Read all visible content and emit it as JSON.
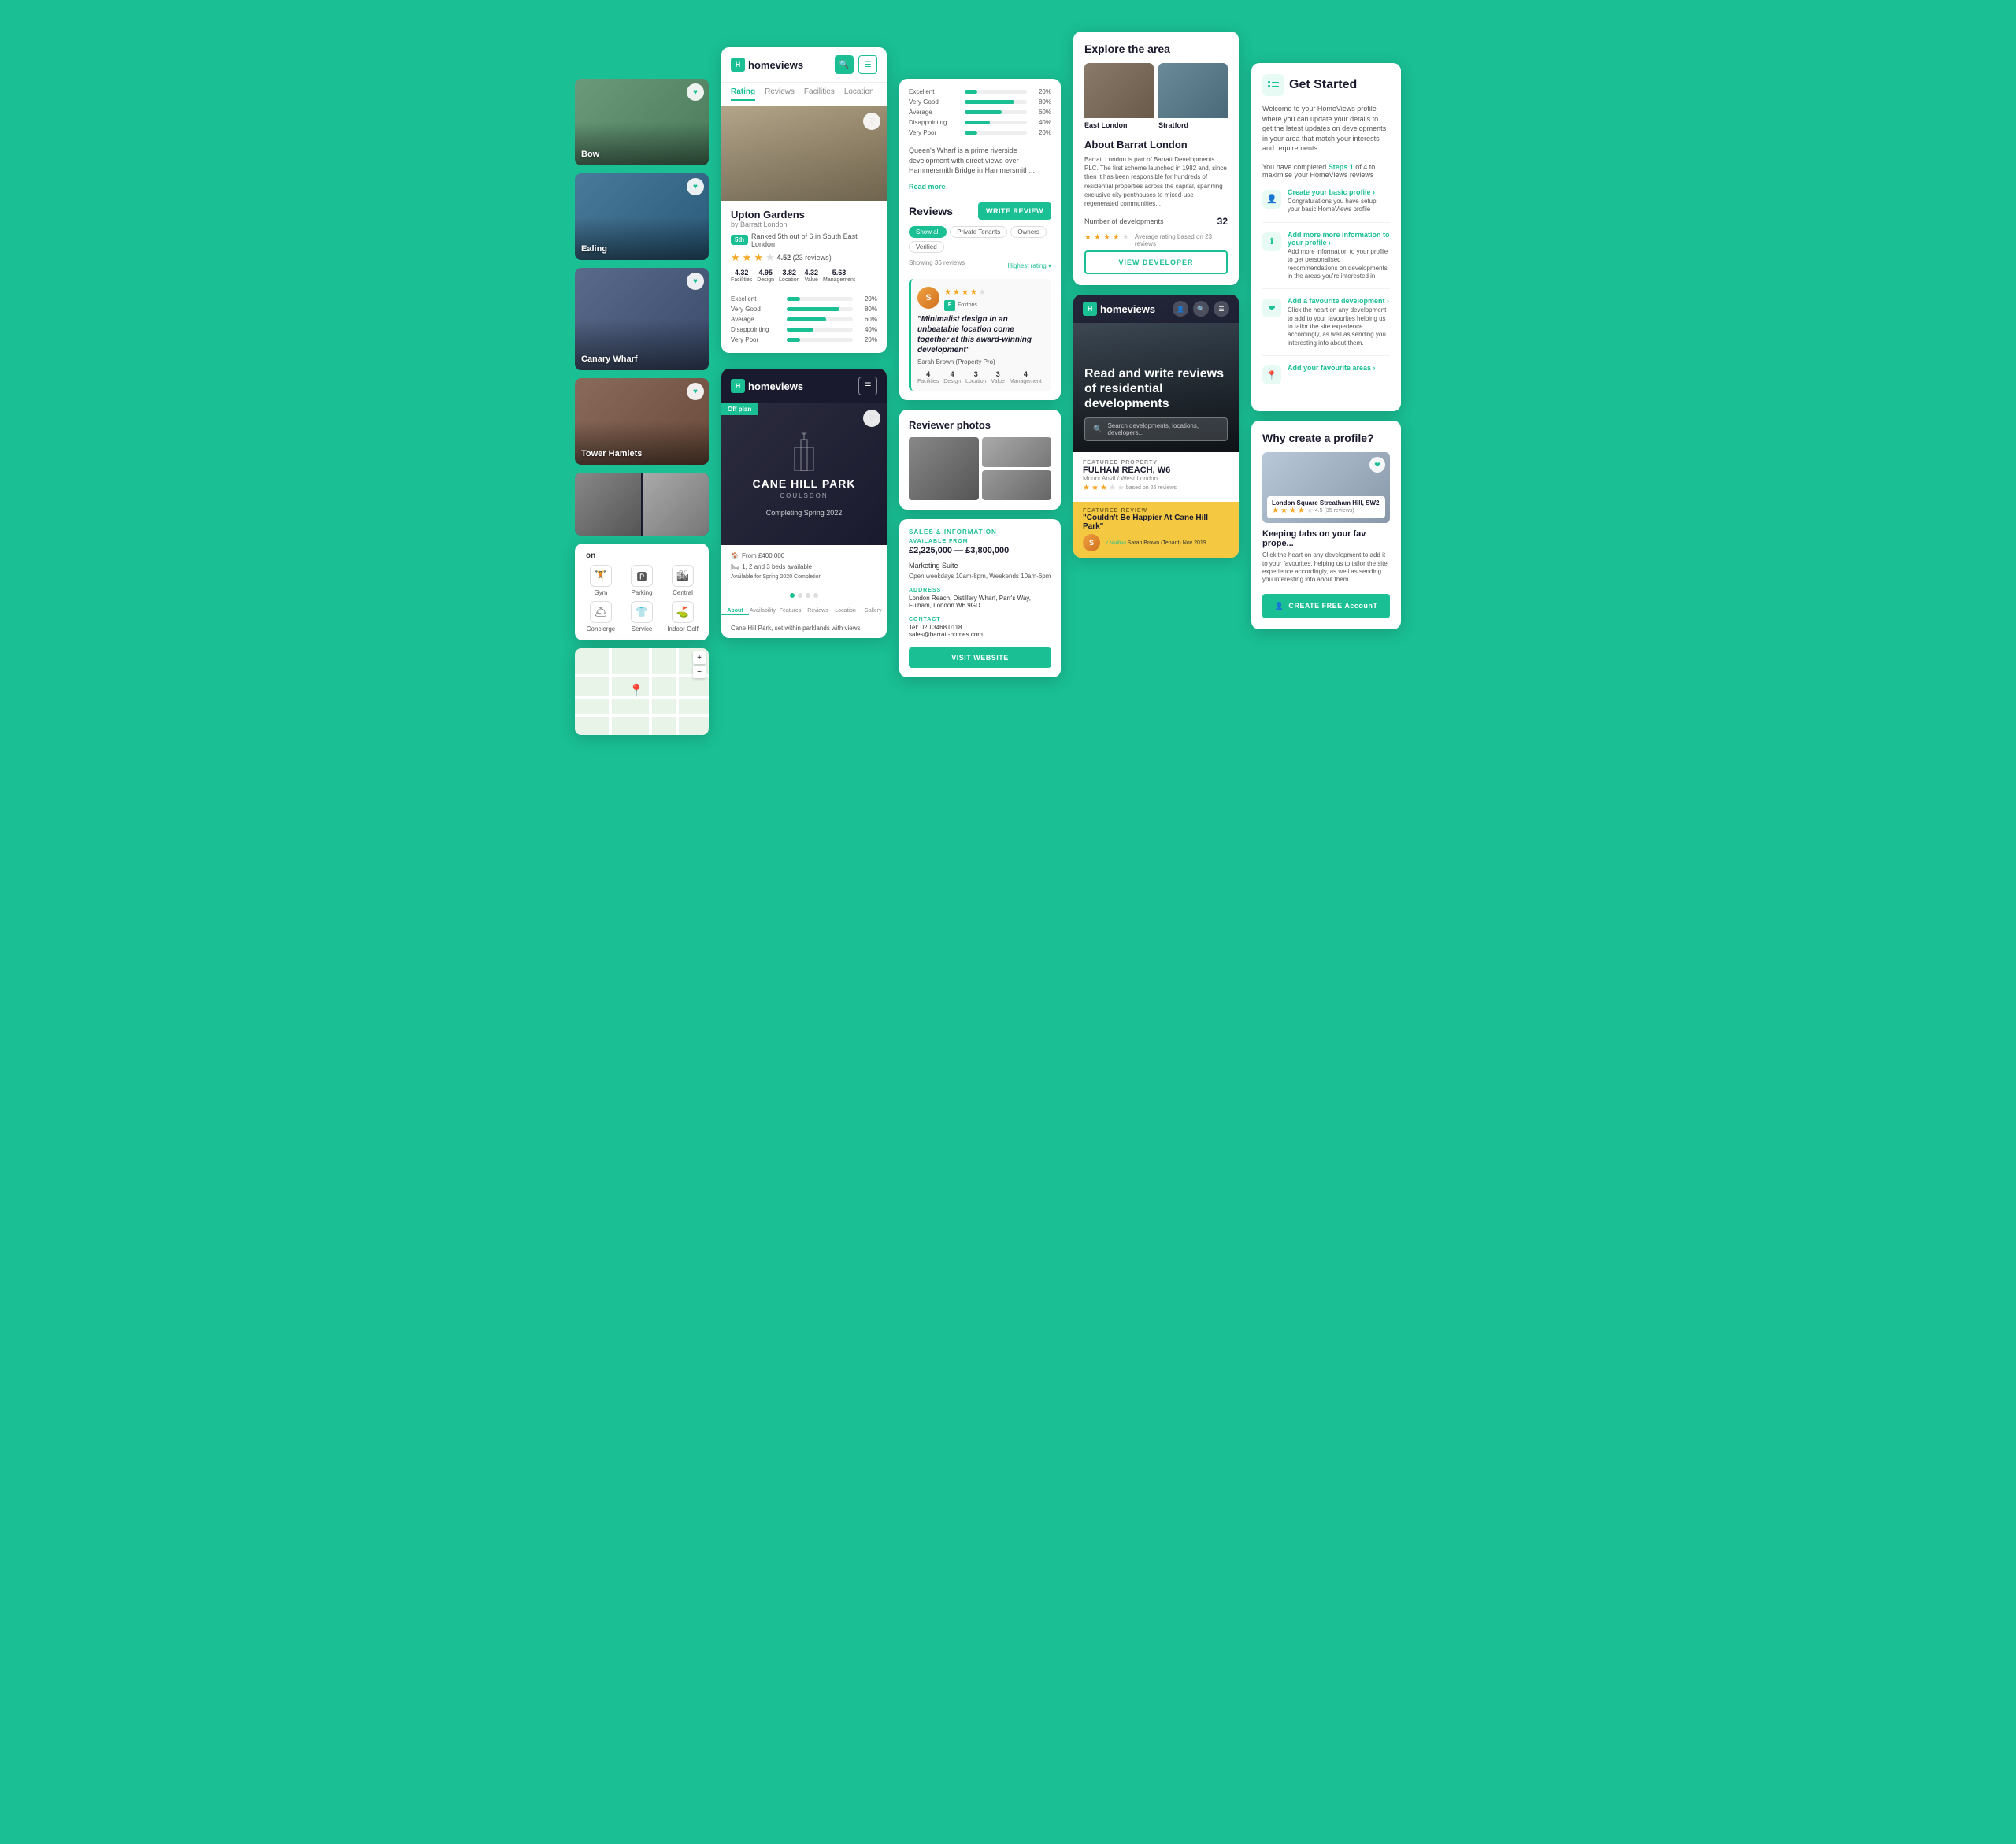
{
  "app": {
    "name": "HomeViews",
    "tagline": "Read and write reviews of residential developments"
  },
  "col1": {
    "locations": [
      {
        "name": "Bow",
        "colorClass": "img-bow"
      },
      {
        "name": "Ealing",
        "colorClass": "img-ealing"
      },
      {
        "name": "Canary Wharf",
        "colorClass": "img-canary"
      },
      {
        "name": "Tower Hamlets",
        "colorClass": "img-tower"
      }
    ],
    "amenities_title": "on",
    "amenities": [
      {
        "icon": "🏋",
        "label": "Gym"
      },
      {
        "icon": "🅿",
        "label": "Parking"
      },
      {
        "icon": "🏙",
        "label": "Central"
      },
      {
        "icon": "🛎",
        "label": "Concierge"
      },
      {
        "icon": "👕",
        "label": "Service"
      },
      {
        "icon": "⛳",
        "label": "Indoor Golf"
      }
    ]
  },
  "col2": {
    "nav_tabs": [
      "Rating",
      "Reviews",
      "Facilities",
      "Location"
    ],
    "property": {
      "name": "Upton Gardens",
      "developer": "by Barratt London",
      "rank_badge": "5th",
      "rank_text": "Ranked 5th out of 6 in South East London",
      "rating": "4.52",
      "review_count": "23 reviews",
      "sub_ratings": [
        {
          "val": "4.32",
          "label": "Facilities"
        },
        {
          "val": "4.95",
          "label": "Design"
        },
        {
          "val": "3.82",
          "label": "Location"
        },
        {
          "val": "4.32",
          "label": "Value"
        },
        {
          "val": "5.63",
          "label": "Management"
        }
      ],
      "rating_bars": [
        {
          "label": "Excellent",
          "pct": "20%",
          "fill": 20
        },
        {
          "label": "Very Good",
          "pct": "80%",
          "fill": 80
        },
        {
          "label": "Average",
          "pct": "60%",
          "fill": 60
        },
        {
          "label": "Disappointing",
          "pct": "40%",
          "fill": 40
        },
        {
          "label": "Very Poor",
          "pct": "20%",
          "fill": 20
        }
      ]
    },
    "cane_hill": {
      "badge": "Off plan",
      "title": "CANE HILL PARK",
      "subtitle": "COULSDON",
      "completing": "Completing Spring 2022",
      "price": "From £400,000",
      "beds": "1, 2 and 3 beds available",
      "availability": "Available for Spring 2020 Completion",
      "tabs": [
        "About",
        "Availability",
        "Features",
        "Reviews",
        "Location",
        "Gallery"
      ],
      "about_text": "Cane Hill Park, set within parklands with views"
    }
  },
  "col3": {
    "reviews_rating_bars": [
      {
        "label": "Excellent",
        "pct": "20%",
        "fill": 20
      },
      {
        "label": "Very Good",
        "pct": "80%",
        "fill": 80
      },
      {
        "label": "Average",
        "pct": "60%",
        "fill": 60
      },
      {
        "label": "Disappointing",
        "pct": "40%",
        "fill": 40
      },
      {
        "label": "Very Poor",
        "pct": "20%",
        "fill": 20
      }
    ],
    "description": "Queen's Wharf is a prime riverside development with direct views over Hammersmith Bridge in Hammersmith...",
    "read_more": "Read more",
    "reviews_section": {
      "title": "Reviews",
      "write_btn": "WRITE REVIEW",
      "show_all": "Show all",
      "filter_tags": [
        "Show all",
        "Private Tenants",
        "Owners",
        "Verified"
      ],
      "showing_text": "Showing 36 reviews",
      "sort": "Highest rating",
      "review": {
        "quote": "\"Minimalist design in an unbeatable location come together at this award-winning development\"",
        "reviewer": "Sarah Brown (Property Pro)",
        "source": "Foxtons",
        "scores": [
          {
            "val": "4",
            "label": "Facilities"
          },
          {
            "val": "4",
            "label": "Design"
          },
          {
            "val": "3",
            "label": "Location"
          },
          {
            "val": "3",
            "label": "Value"
          },
          {
            "val": "4",
            "label": "Management"
          }
        ]
      }
    },
    "photos": {
      "title": "Reviewer photos"
    },
    "sales": {
      "section_label": "SALES & INFORMATION",
      "available_label": "AVAILABLE FROM",
      "price_range": "£2,225,000 — £3,800,000",
      "marketing_label": "Marketing Suite",
      "marketing_hours": "Open weekdays 10am-8pm, Weekends 10am-6pm",
      "address_label": "ADDRESS",
      "address": "London Reach, Distillery Wharf, Parr's Way, Fulham, London W6 9GD",
      "contact_label": "CONTACT",
      "phone": "Tel: 020 3468 0118",
      "email": "sales@barratt-homes.com",
      "visit_btn": "VISIT WEBSITE"
    }
  },
  "col4": {
    "explore": {
      "title": "Explore the area",
      "areas": [
        {
          "name": "East London",
          "colorClass": "img-eastlondon"
        },
        {
          "name": "Stratford",
          "colorClass": "img-stratford"
        }
      ]
    },
    "barratt": {
      "about_title": "About Barrat London",
      "about_text": "Barratt London is part of Barratt Developments PLC. The first scheme launched in 1982 and, since then it has been responsible for hundreds of residential properties across the capital, spanning exclusive city penthouses to mixed-use regenerated communities...",
      "num_developments_label": "Number of developments",
      "num_developments_val": "32",
      "rating_text": "Average rating based on 23 reviews",
      "view_btn": "VIEW DEVELOPER"
    },
    "app": {
      "headline": "Read and write reviews of residential developments",
      "search_placeholder": "Search developments, locations, developers...",
      "featured_label": "FEATURED PROPERTY",
      "featured_name": "FULHAM REACH, W6",
      "featured_loc": "Mount Anvil / West London",
      "featured_review_label": "FEATURED REVIEW",
      "featured_quote": "\"Couldn't Be Happier At Cane Hill Park\"",
      "featured_reviewer": "Sarah Brown (Tenant)",
      "featured_date": "Nov 2019",
      "verified": "✓ Verified"
    }
  },
  "col5": {
    "get_started": {
      "title": "Get Started",
      "desc": "Welcome to your HomeViews profile where you can update your details to get the latest updates on developments in your area that match your interests and requirements",
      "progress": "You have completed Steps 1 of 4 to maximise your HomeViews reviews",
      "steps": [
        {
          "icon": "👤",
          "title": "Create your basic profile ›",
          "desc": "Congratulations you have setup your basic HomeViews profile"
        },
        {
          "icon": "ℹ",
          "title": "Add more more information to your profile ›",
          "desc": "Add more information to your profile to get personalised recommendations on developments in the areas you're interested in"
        },
        {
          "icon": "❤",
          "title": "Add a favourite development ›",
          "desc": "Click the heart on any development to add to your favourites helping us to tailor the site experience accordingly, as well as sending you interesting info about them."
        },
        {
          "icon": "📍",
          "title": "Add your favourite areas ›",
          "desc": ""
        }
      ]
    },
    "why": {
      "title": "Why create a profile?",
      "prop_name": "London Square Streatham Hill, SW2",
      "keeping_title": "Keeping tabs on your fav prope...",
      "keeping_text": "Click the heart on any development to add it to your favourites, helping us to tailor the site experience accordingly, as well as sending you interesting info about them.",
      "create_btn": "CREATE FREE AccounT"
    }
  }
}
